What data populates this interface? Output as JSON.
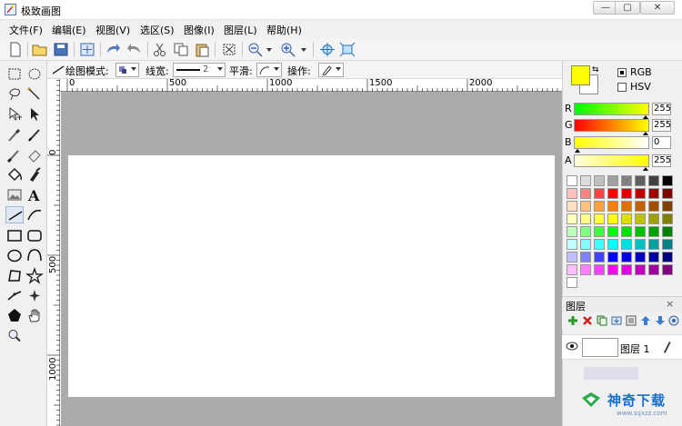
{
  "window": {
    "title": "极致画图",
    "min_label": "—",
    "max_label": "▢",
    "close_label": "✕"
  },
  "menu": [
    {
      "label": "文件(F)"
    },
    {
      "label": "编辑(E)"
    },
    {
      "label": "视图(V)"
    },
    {
      "label": "选区(S)"
    },
    {
      "label": "图像(I)"
    },
    {
      "label": "图层(L)"
    },
    {
      "label": "帮助(H)"
    }
  ],
  "toolbar_icons": [
    "new-icon",
    "open-icon",
    "save-icon",
    "resize-icon",
    "undo-icon",
    "redo-icon",
    "cut-icon",
    "copy-icon",
    "paste-icon",
    "crop-icon",
    "zoom-out-icon",
    "zoom-in-icon",
    "fit-icon",
    "actual-size-icon"
  ],
  "options": {
    "draw_mode_label": "绘图模式:",
    "line_width_label": "线宽:",
    "line_width_value": "2",
    "smooth_label": "平滑:",
    "operation_label": "操作:"
  },
  "ruler": {
    "h_labels": [
      "0",
      "500",
      "1000",
      "1500",
      "2000"
    ],
    "v_labels": [
      "0",
      "500",
      "1000"
    ]
  },
  "colors": {
    "foreground": "#ffff00",
    "background": "#ffffff",
    "mode_rgb": "RGB",
    "mode_hsv": "HSV",
    "channels": [
      {
        "label": "R",
        "value": "255",
        "from": "#00ff00",
        "to": "#ffff00",
        "level": 1.0
      },
      {
        "label": "G",
        "value": "255",
        "from": "#ff0000",
        "to": "#ffff00",
        "level": 1.0
      },
      {
        "label": "B",
        "value": "0",
        "from": "#ffff00",
        "to": "#ffffff",
        "level": 0.0
      },
      {
        "label": "A",
        "value": "255",
        "from": "#fffde0",
        "to": "#ffff00",
        "level": 1.0
      }
    ]
  },
  "palette_rows": [
    [
      "#ffffff",
      "#dcdcdc",
      "#c0c0c0",
      "#a0a0a0",
      "#808080",
      "#606060",
      "#404040",
      "#000000"
    ],
    [
      "#ffc0c0",
      "#ff8080",
      "#ff4040",
      "#ff0000",
      "#e00000",
      "#c00000",
      "#a00000",
      "#800000"
    ],
    [
      "#ffe0c0",
      "#ffc080",
      "#ffa040",
      "#ff8000",
      "#e07000",
      "#c06000",
      "#a05000",
      "#804000"
    ],
    [
      "#ffffc0",
      "#ffff80",
      "#ffff40",
      "#ffff00",
      "#e0e000",
      "#c0c000",
      "#a0a000",
      "#808000"
    ],
    [
      "#c0ffc0",
      "#80ff80",
      "#40ff40",
      "#00ff00",
      "#00e000",
      "#00c000",
      "#00a000",
      "#008000"
    ],
    [
      "#c0ffff",
      "#80ffff",
      "#40ffff",
      "#00ffff",
      "#00e0e0",
      "#00c0c0",
      "#00a0a0",
      "#008080"
    ],
    [
      "#c0c0ff",
      "#8080ff",
      "#4040ff",
      "#0000ff",
      "#0000e0",
      "#0000c0",
      "#0000a0",
      "#000080"
    ],
    [
      "#ffc0ff",
      "#ff80ff",
      "#ff40ff",
      "#ff00ff",
      "#e000e0",
      "#c000c0",
      "#a000a0",
      "#800080"
    ],
    [
      "#ffffff"
    ]
  ],
  "layers": {
    "title": "图层",
    "close": "×",
    "items": [
      {
        "name": "图层 1",
        "visible": true
      }
    ]
  },
  "watermark": {
    "brand": "神奇下载",
    "url": "www.sqxzz.com"
  }
}
